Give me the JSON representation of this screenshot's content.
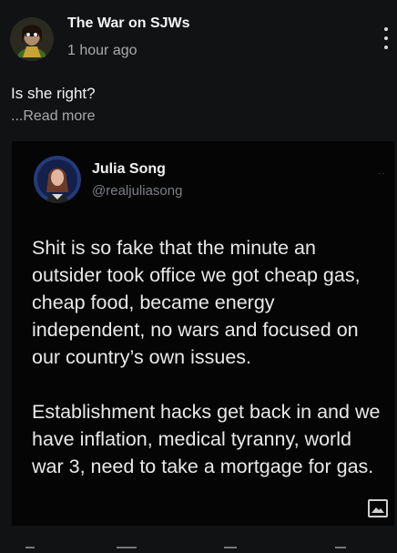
{
  "post": {
    "channel_name": "The War on SJWs",
    "time": "1 hour ago",
    "text": "Is she right?",
    "read_more": "...Read more"
  },
  "tweet": {
    "display_name": "Julia Song",
    "handle": "@realjuliasong",
    "more": "··",
    "paragraphs": [
      "Shit is so fake that the minute an outsider took office we got cheap gas, cheap food, became energy independent, no wars and focused on our country’s own issues.",
      "Establishment hacks get back in and we have inflation, medical tyranny, world war 3, need to take a mortgage for gas."
    ]
  },
  "icons": {
    "more_menu": "vertical-ellipsis-icon",
    "image": "image-icon"
  },
  "colors": {
    "background": "#111214",
    "card": "#050505",
    "secondary_text": "#aaaaaa",
    "handle_text": "#7c7f84"
  }
}
